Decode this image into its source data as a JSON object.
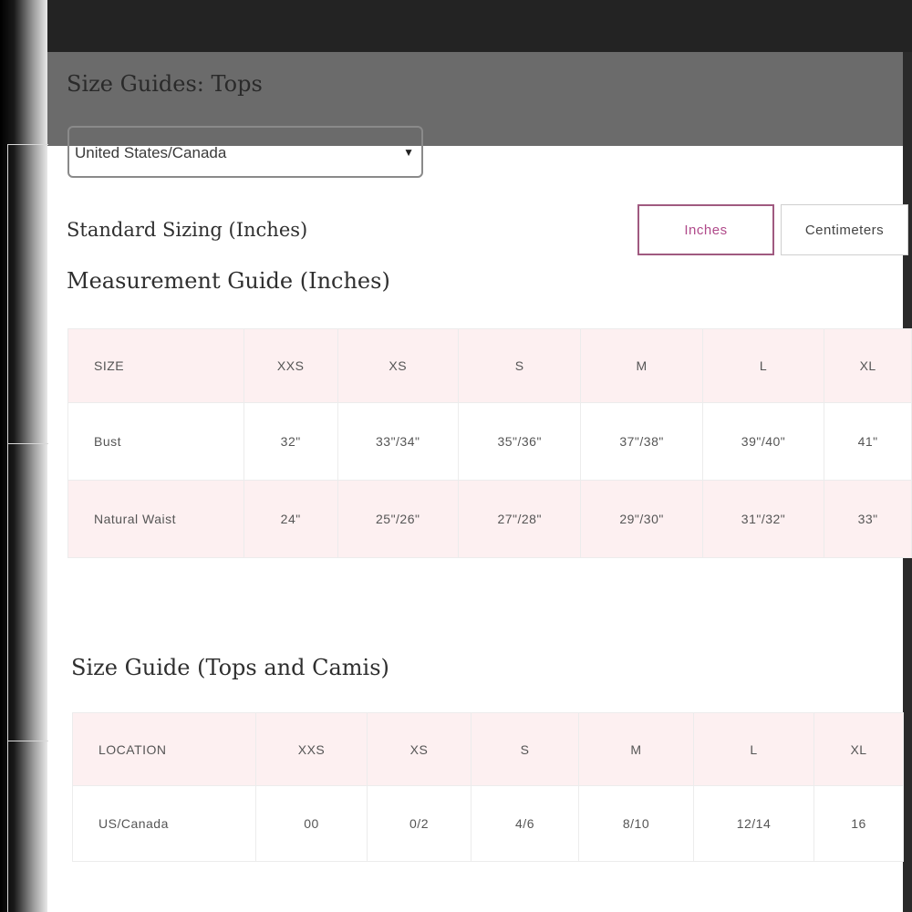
{
  "modal": {
    "title": "Size Guides: Tops"
  },
  "region_select": {
    "value": "United States/Canada",
    "arrow": "▼"
  },
  "units": {
    "sizing_label": "Standard Sizing (Inches)",
    "inches": "Inches",
    "centimeters": "Centimeters",
    "selected": "Inches"
  },
  "measurement_guide": {
    "title": "Measurement Guide (Inches)",
    "headers": [
      "SIZE",
      "XXS",
      "XS",
      "S",
      "M",
      "L",
      "XL"
    ],
    "rows": [
      [
        "Bust",
        "32\"",
        "33\"/34\"",
        "35\"/36\"",
        "37\"/38\"",
        "39\"/40\"",
        "41\""
      ],
      [
        "Natural Waist",
        "24\"",
        "25\"/26\"",
        "27\"/28\"",
        "29\"/30\"",
        "31\"/32\"",
        "33\""
      ]
    ]
  },
  "tops_guide": {
    "title": "Size Guide (Tops and Camis)",
    "headers": [
      "LOCATION",
      "XXS",
      "XS",
      "S",
      "M",
      "L",
      "XL"
    ],
    "rows": [
      [
        "US/Canada",
        "00",
        "0/2",
        "4/6",
        "8/10",
        "12/14",
        "16"
      ]
    ]
  },
  "colors": {
    "accent": "#b04a8a",
    "row_pink": "#fdf0f1"
  }
}
